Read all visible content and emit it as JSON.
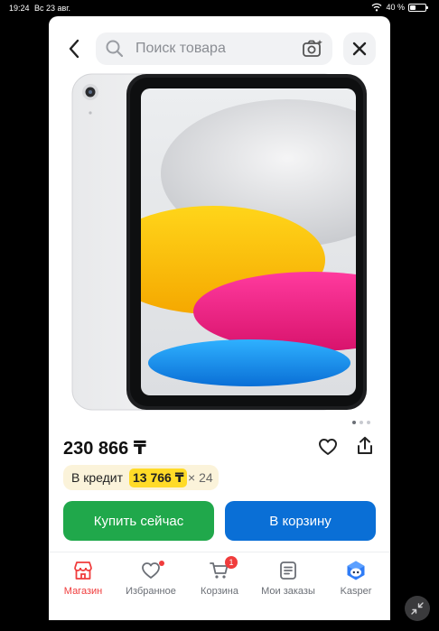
{
  "status_bar": {
    "time": "19:24",
    "date": "Вс 23 авг.",
    "battery": "40 %",
    "battery_level": 0.4
  },
  "search": {
    "placeholder": "Поиск товара"
  },
  "product": {
    "price": "230 866 ₸"
  },
  "credit": {
    "label": "В кредит",
    "amount": "13 766 ₸",
    "term": "× 24"
  },
  "actions": {
    "buy_now": "Купить сейчас",
    "add_to_cart": "В корзину"
  },
  "pager": {
    "count": 3,
    "active": 0
  },
  "tabbar": {
    "items": [
      {
        "label": "Магазин",
        "icon": "store-icon",
        "active": true
      },
      {
        "label": "Избранное",
        "icon": "heart-icon",
        "dot": true
      },
      {
        "label": "Корзина",
        "icon": "cart-icon",
        "badge": "1"
      },
      {
        "label": "Мои заказы",
        "icon": "orders-icon"
      },
      {
        "label": "Kasper",
        "icon": "kasper-icon"
      }
    ]
  },
  "colors": {
    "accent_red": "#f03c3c",
    "buy_green": "#20a84b",
    "cart_blue": "#0a6fd6",
    "credit_yellow": "#ffdb27"
  }
}
